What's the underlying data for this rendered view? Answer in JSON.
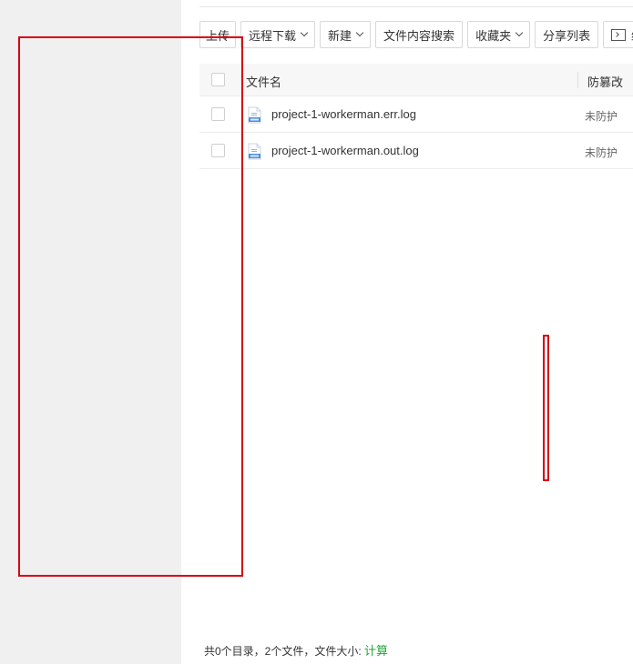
{
  "toolbar": {
    "upload": "上传",
    "remote_download": "远程下载",
    "new": "新建",
    "content_search": "文件内容搜索",
    "favorites": "收藏夹",
    "share_list": "分享列表",
    "terminal": "终"
  },
  "table": {
    "headers": {
      "name": "文件名",
      "protect": "防篡改"
    },
    "rows": [
      {
        "name": "project-1-workerman.err.log",
        "protect": "未防护",
        "icon": "log-file-icon"
      },
      {
        "name": "project-1-workerman.out.log",
        "protect": "未防护",
        "icon": "log-file-icon"
      }
    ]
  },
  "footer": {
    "summary": "共0个目录，2个文件，文件大小:",
    "calc": "计算"
  },
  "colors": {
    "accent": "#20a53a",
    "annotation": "#d7000f",
    "file_icon": "#4a90e2"
  }
}
